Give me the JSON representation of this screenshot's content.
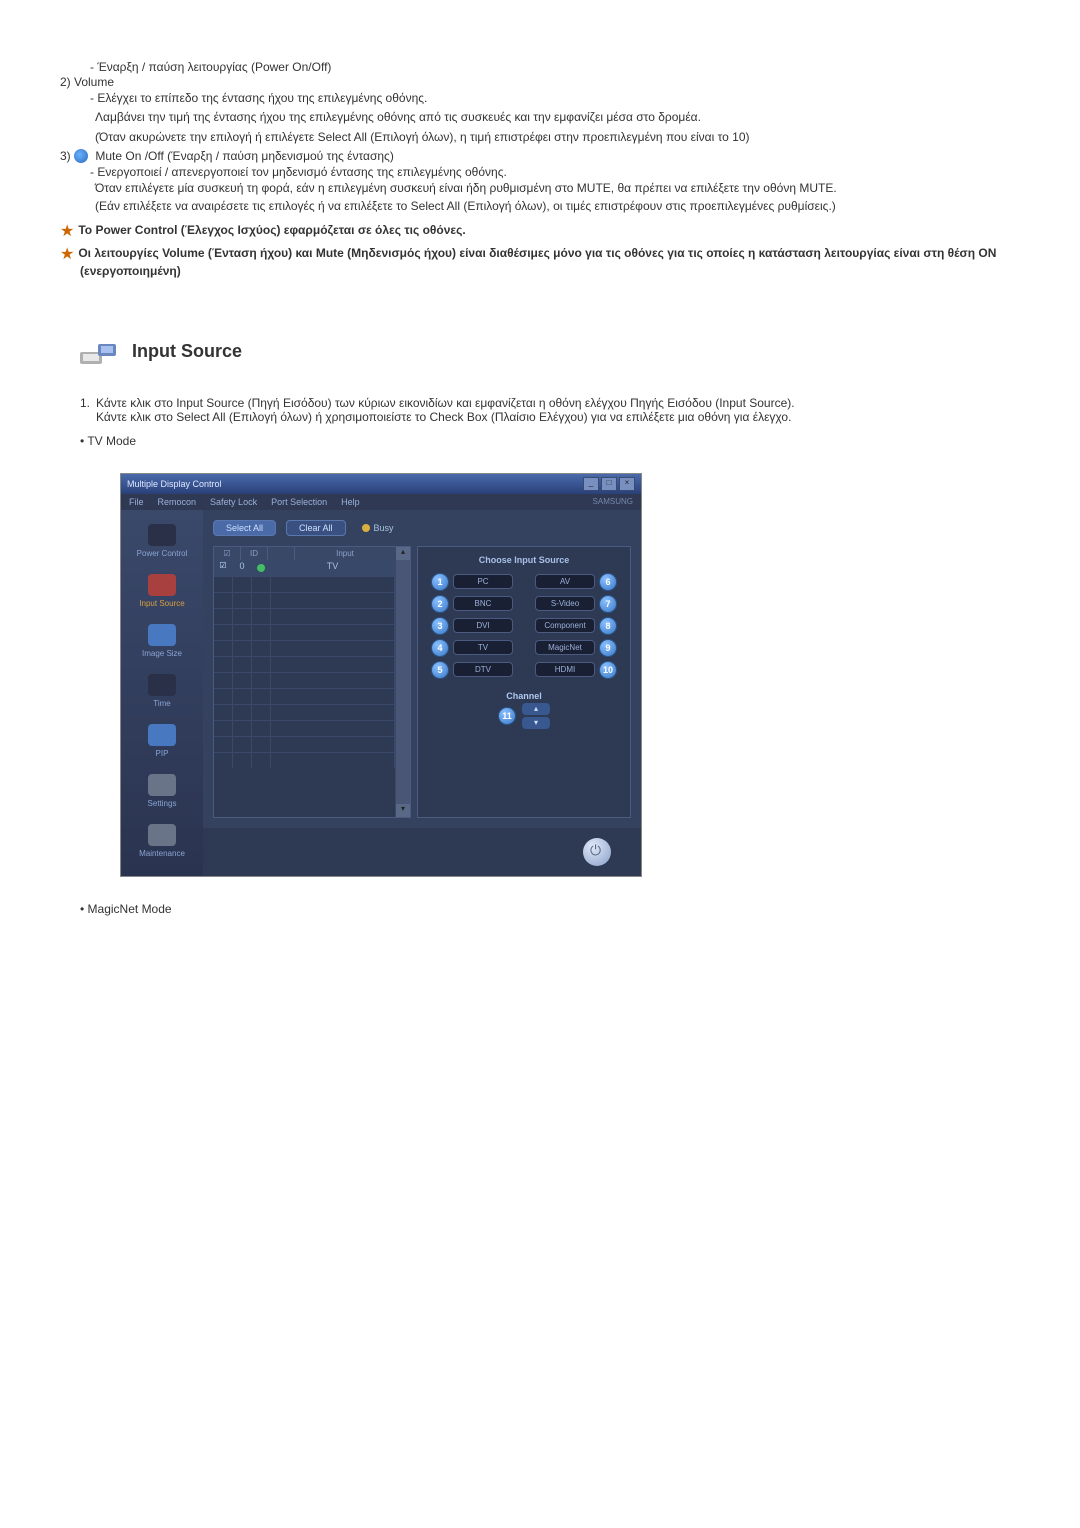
{
  "list1": {
    "power_dash": "- Έναρξη / παύση λειτουργίας (Power On/Off)",
    "item2_num": "2)  Volume",
    "item2_dash": "- Ελέγχει το επίπεδο της έντασης ήχου της επιλεγμένης οθόνης.",
    "item2_line2": "Λαμβάνει την τιμή της έντασης ήχου της επιλεγμένης οθόνης από τις συσκευές και την εμφανίζει μέσα στο δρομέα.",
    "item2_line3": "(Όταν ακυρώνετε την επιλογή ή επιλέγετε Select All (Επιλογή όλων), η τιμή επιστρέφει στην προεπιλεγμένη που είναι το 10)",
    "item3_num": "3)",
    "item3_label": "Mute On /Off (Έναρξη / παύση μηδενισμού της έντασης)",
    "item3_dash": "- Ενεργοποιεί / απενεργοποιεί τον μηδενισμό έντασης της επιλεγμένης οθόνης.",
    "item3_line2": "Όταν επιλέγετε μία συσκευή τη φορά, εάν η επιλεγμένη συσκευή είναι ήδη ρυθμισμένη στο MUTE, θα πρέπει να επιλέξετε την οθόνη MUTE.",
    "item3_line3": "(Εάν επιλέξετε να αναιρέσετε τις επιλογές ή να επιλέξετε το Select All (Επιλογή όλων), οι τιμές επιστρέφουν στις προεπιλεγμένες ρυθμίσεις.)"
  },
  "stars": {
    "s1": "Το Power Control (Έλεγχος Ισχύος) εφαρμόζεται σε όλες τις οθόνες.",
    "s2": "Οι λειτουργίες Volume (Ένταση ήχου) και Mute (Μηδενισμός ήχου) είναι διαθέσιμες μόνο για τις οθόνες για τις οποίες η κατάσταση λειτουργίας είναι στη θέση ON (ενεργοποιημένη)"
  },
  "section": {
    "title": "Input Source"
  },
  "body": {
    "p1_num": "1.",
    "p1": "Κάντε κλικ στο Input Source (Πηγή Εισόδου) των κύριων εικονιδίων και εμφανίζεται η οθόνη ελέγχου Πηγής Εισόδου (Input Source).",
    "p2": "Κάντε κλικ στο Select All (Επιλογή όλων) ή χρησιμοποιείστε το Check Box (Πλαίσιο Ελέγχου) για να επιλέξετε μια οθόνη για έλεγχο.",
    "tv_mode": "TV Mode",
    "magic_mode": "MagicNet Mode"
  },
  "app": {
    "title": "Multiple Display Control",
    "menu": {
      "file": "File",
      "remocon": "Remocon",
      "safety": "Safety Lock",
      "port": "Port Selection",
      "help": "Help",
      "brand": "SAMSUNG"
    },
    "side": {
      "power": "Power Control",
      "input": "Input Source",
      "image": "Image Size",
      "time": "Time",
      "pip": "PIP",
      "settings": "Settings",
      "maint": "Maintenance"
    },
    "buttons": {
      "select_all": "Select All",
      "clear_all": "Clear All",
      "busy": "Busy"
    },
    "grid": {
      "head_chk": "☑",
      "head_id": "ID",
      "head_st": "",
      "head_input": "Input",
      "row1_id": "0",
      "row1_input": "TV"
    },
    "panel": {
      "title": "Choose Input Source",
      "left": [
        {
          "n": "1",
          "label": "PC"
        },
        {
          "n": "2",
          "label": "BNC"
        },
        {
          "n": "3",
          "label": "DVI"
        },
        {
          "n": "4",
          "label": "TV"
        },
        {
          "n": "5",
          "label": "DTV"
        }
      ],
      "right": [
        {
          "n": "6",
          "label": "AV"
        },
        {
          "n": "7",
          "label": "S-Video"
        },
        {
          "n": "8",
          "label": "Component"
        },
        {
          "n": "9",
          "label": "MagicNet"
        },
        {
          "n": "10",
          "label": "HDMI"
        }
      ],
      "channel": "Channel",
      "chan_badge": "11",
      "up": "▴",
      "down": "▾"
    }
  }
}
